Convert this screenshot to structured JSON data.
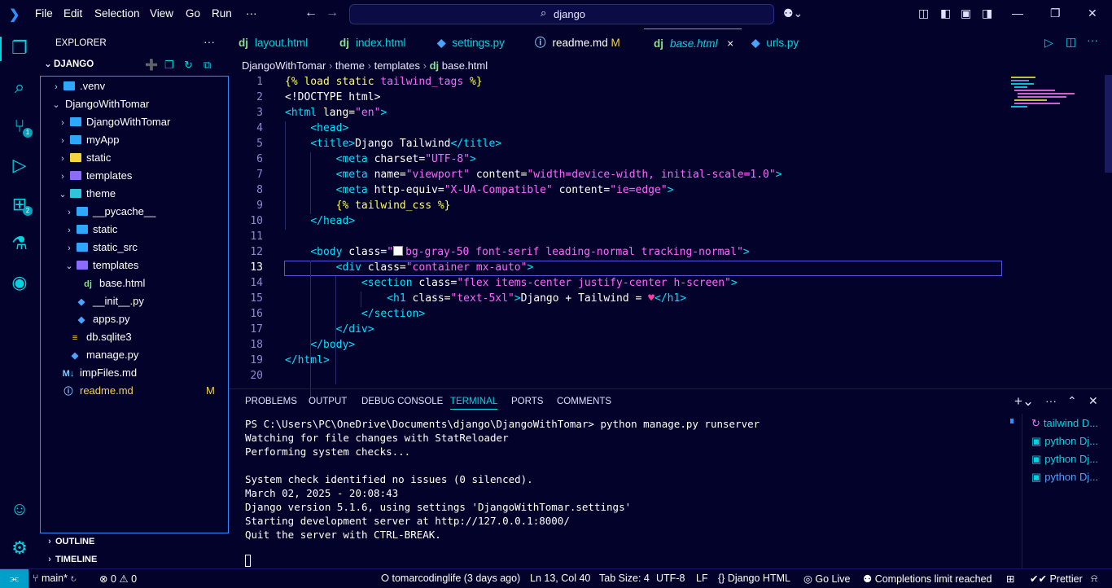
{
  "titlebar": {
    "menu": [
      "File",
      "Edit",
      "Selection",
      "View",
      "Go",
      "Run",
      "···"
    ],
    "search_text": "django"
  },
  "explorer": {
    "title": "EXPLORER",
    "root": "DJANGO",
    "tree": [
      {
        "label": ".venv",
        "chev": "›",
        "icon": "f-blue",
        "indent": 0
      },
      {
        "label": "DjangoWithTomar",
        "chev": "⌄",
        "icon": "",
        "indent": 0
      },
      {
        "label": "DjangoWithTomar",
        "chev": "›",
        "icon": "f-blue",
        "indent": 1
      },
      {
        "label": "myApp",
        "chev": "›",
        "icon": "f-blue",
        "indent": 1
      },
      {
        "label": "static",
        "chev": "›",
        "icon": "f-yellow",
        "indent": 1
      },
      {
        "label": "templates",
        "chev": "›",
        "icon": "f-purple",
        "indent": 1
      },
      {
        "label": "theme",
        "chev": "⌄",
        "icon": "f-teal",
        "indent": 1
      },
      {
        "label": "__pycache__",
        "chev": "›",
        "icon": "f-blue",
        "indent": 2
      },
      {
        "label": "static",
        "chev": "›",
        "icon": "f-blue",
        "indent": 2
      },
      {
        "label": "static_src",
        "chev": "›",
        "icon": "f-blue",
        "indent": 2
      },
      {
        "label": "templates",
        "chev": "⌄",
        "icon": "f-purple",
        "indent": 2
      },
      {
        "label": "base.html",
        "chev": "",
        "icon": "dj",
        "indent": 3
      },
      {
        "label": "__init__.py",
        "chev": "",
        "icon": "py",
        "indent": 2
      },
      {
        "label": "apps.py",
        "chev": "",
        "icon": "py",
        "indent": 2
      },
      {
        "label": "db.sqlite3",
        "chev": "",
        "icon": "db",
        "indent": 1
      },
      {
        "label": "manage.py",
        "chev": "",
        "icon": "py",
        "indent": 1
      },
      {
        "label": "impFiles.md",
        "chev": "",
        "icon": "md",
        "indent": 0
      },
      {
        "label": "readme.md",
        "chev": "",
        "icon": "i",
        "indent": 0,
        "badge": "M"
      }
    ],
    "outline": "OUTLINE",
    "timeline": "TIMELINE"
  },
  "tabs": [
    {
      "label": "layout.html",
      "icon": "dj"
    },
    {
      "label": "index.html",
      "icon": "dj"
    },
    {
      "label": "settings.py",
      "icon": "py"
    },
    {
      "label": "readme.md",
      "icon": "i",
      "badge": "M"
    },
    {
      "label": "base.html",
      "icon": "dj",
      "close": "×"
    },
    {
      "label": "urls.py",
      "icon": "py"
    }
  ],
  "breadcrumb": [
    "DjangoWithTomar",
    "theme",
    "templates",
    "base.html"
  ],
  "editor": {
    "current_line": 13,
    "line_numbers": [
      "1",
      "2",
      "3",
      "4",
      "5",
      "6",
      "7",
      "8",
      "9",
      "10",
      "11",
      "12",
      "13",
      "14",
      "15",
      "16",
      "17",
      "18",
      "19",
      "20"
    ]
  },
  "panel": {
    "tabs": [
      "PROBLEMS",
      "OUTPUT",
      "DEBUG CONSOLE",
      "TERMINAL",
      "PORTS",
      "COMMENTS"
    ],
    "active_tab": "TERMINAL",
    "terminal_lines": [
      "PS C:\\Users\\PC\\OneDrive\\Documents\\django\\DjangoWithTomar> python manage.py runserver",
      "Watching for file changes with StatReloader",
      "Performing system checks...",
      "",
      "System check identified no issues (0 silenced).",
      "March 02, 2025 - 20:08:43",
      "Django version 5.1.6, using settings 'DjangoWithTomar.settings'",
      "Starting development server at http://127.0.0.1:8000/",
      "Quit the server with CTRL-BREAK."
    ],
    "instances": [
      "tailwind D...",
      "python Dj...",
      "python Dj...",
      "python Dj..."
    ]
  },
  "statusbar": {
    "branch": "main*",
    "errors": "0",
    "warnings": "0",
    "blame": "tomarcodinglife (3 days ago)",
    "position": "Ln 13, Col 40",
    "tab_size": "Tab Size: 4",
    "encoding": "UTF-8",
    "eol": "LF",
    "language": "Django HTML",
    "go_live": "Go Live",
    "completions": "Completions limit reached",
    "prettier": "Prettier"
  },
  "colors": {
    "background": "#02022a",
    "accent": "#00d4e0",
    "tag": "#00e0ff",
    "string": "#ff66ff",
    "template": "#ffff55"
  }
}
